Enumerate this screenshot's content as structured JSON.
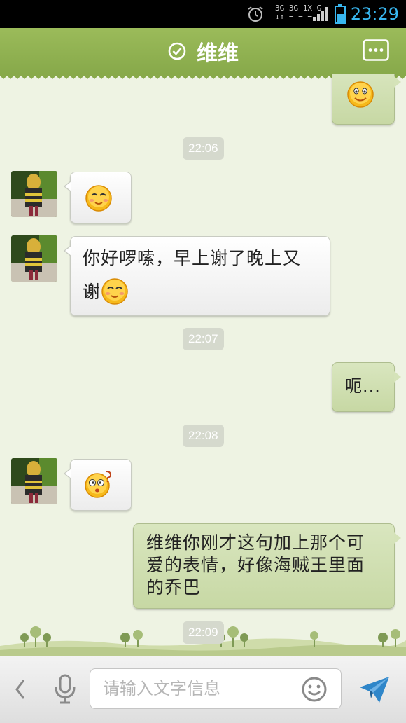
{
  "status_bar": {
    "time": "23:29",
    "network_line1": "3G 3G 1X G",
    "network_line2": "↓↑ ≡ ≡ ≡"
  },
  "header": {
    "title": "维维"
  },
  "messages": [
    {
      "type": "emoji",
      "direction": "out",
      "emoji": "smile-emoji"
    },
    {
      "type": "time",
      "text": "22:06"
    },
    {
      "type": "emoji",
      "direction": "in",
      "emoji": "blush-emoji"
    },
    {
      "type": "text",
      "direction": "in",
      "text_line1": "你好啰嗦，早上谢了晚上又",
      "text_line2": "谢",
      "emoji": "blush-emoji"
    },
    {
      "type": "time",
      "text": "22:07"
    },
    {
      "type": "text",
      "direction": "out",
      "text": "呃..."
    },
    {
      "type": "time",
      "text": "22:08"
    },
    {
      "type": "emoji",
      "direction": "in",
      "emoji": "confused-emoji"
    },
    {
      "type": "text",
      "direction": "out",
      "text_line1": "维维你刚才这句加上那个可",
      "text_line2": "爱的表情，好像海贼王里面",
      "text_line3": "的乔巴"
    },
    {
      "type": "time",
      "text": "22:09"
    }
  ],
  "input_bar": {
    "placeholder": "请输入文字信息"
  },
  "colors": {
    "header": "#8fb04f",
    "chat_bg": "#eef3e3",
    "bubble_out": "#cfdfae",
    "bubble_in": "#ffffff",
    "time_accent": "#38b7f0"
  }
}
